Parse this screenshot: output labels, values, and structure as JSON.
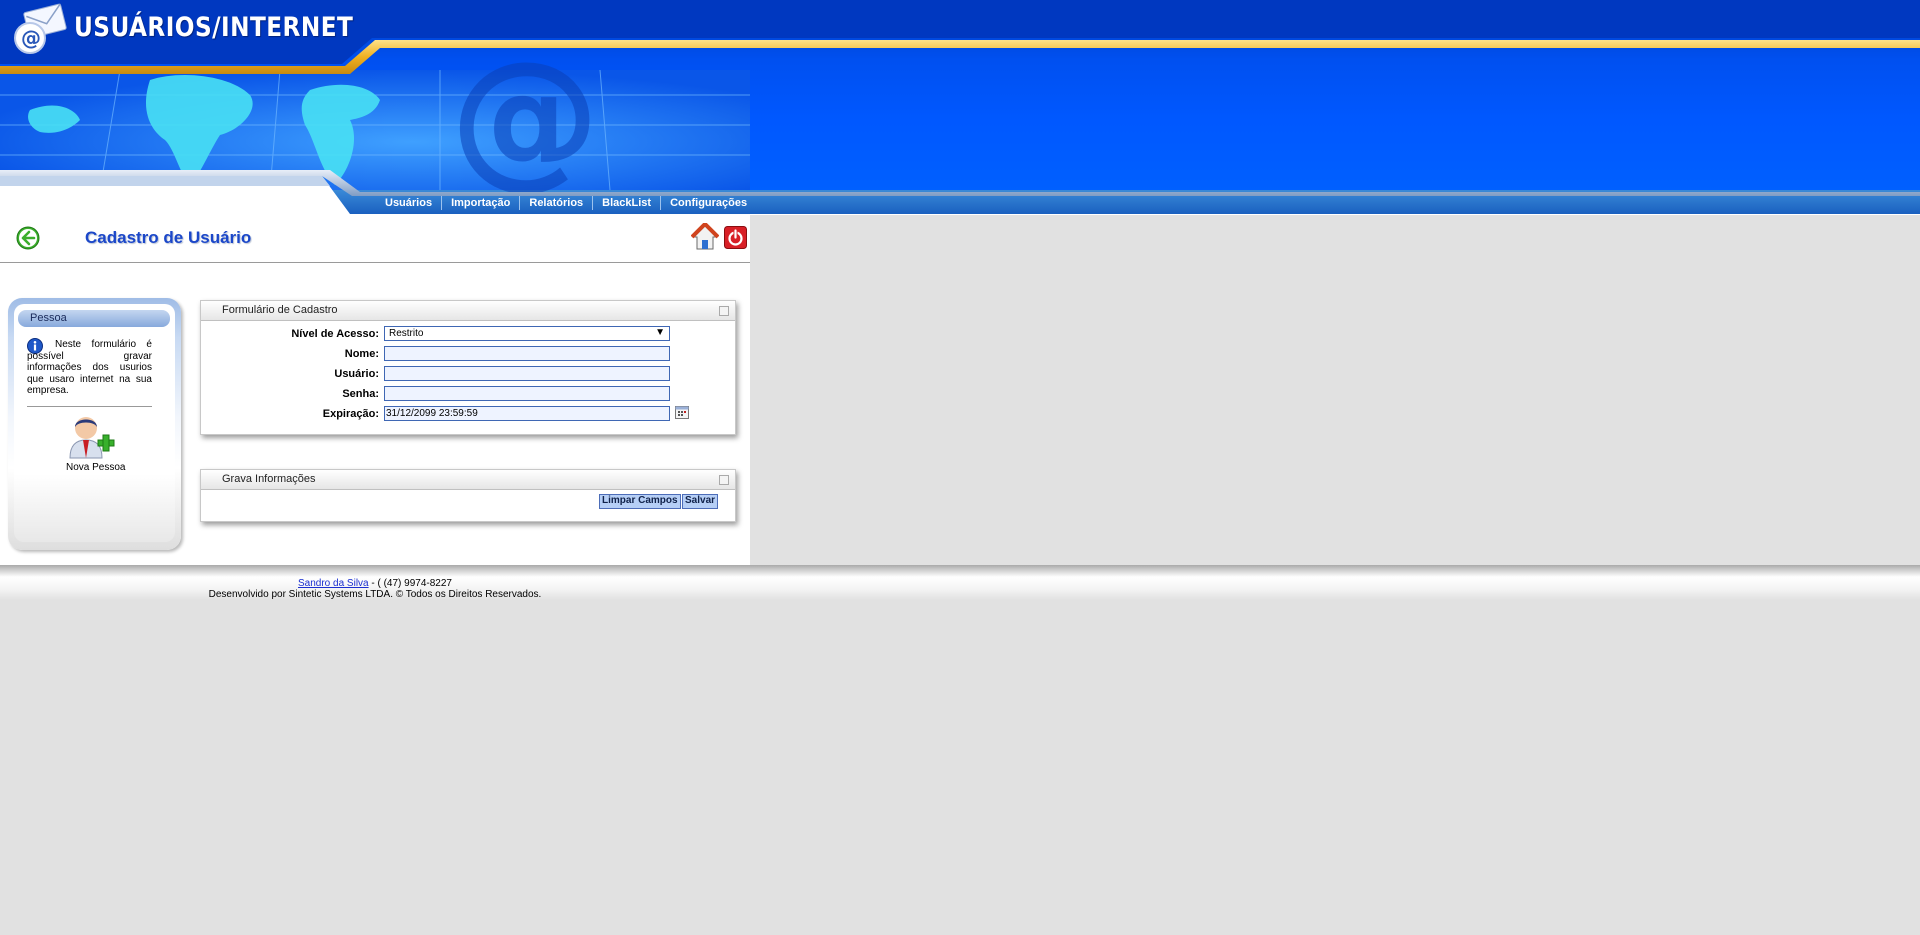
{
  "app": {
    "title": "USUÁRIOS/INTERNET"
  },
  "nav": {
    "items": [
      "Usuários",
      "Importação",
      "Relatórios",
      "BlackList",
      "Configurações"
    ]
  },
  "page": {
    "title": "Cadastro de Usuário"
  },
  "sidebar": {
    "title": "Pessoa",
    "description": "Neste formulário é possível gravar informações dos usurios que usaro internet na sua empresa.",
    "new_person_label": "Nova Pessoa"
  },
  "form": {
    "title": "Formulário de Cadastro",
    "fields": {
      "access_level": {
        "label": "Nível de Acesso:",
        "value": "Restrito"
      },
      "name": {
        "label": "Nome:",
        "value": ""
      },
      "user": {
        "label": "Usuário:",
        "value": ""
      },
      "password": {
        "label": "Senha:",
        "value": ""
      },
      "expiration": {
        "label": "Expiração:",
        "value": "31/12/2099 23:59:59"
      }
    }
  },
  "save_panel": {
    "title": "Grava Informações",
    "clear_label": "Limpar Campos",
    "save_label": "Salvar"
  },
  "footer": {
    "author": "Sandro da Silva",
    "phone": " - ( (47) 9974-8227",
    "copyright": "Desenvolvido por Sintetic Systems LTDA. © Todos os Direitos Reservados."
  },
  "icons": {
    "logo": "email-at-icon",
    "back": "back-arrow-icon",
    "home": "home-icon",
    "power": "power-icon",
    "info": "info-icon",
    "new_person": "add-person-icon",
    "calendar": "calendar-icon"
  },
  "colors": {
    "header_blue": "#0050f0",
    "accent_gold": "#f0b020",
    "title_blue": "#1b47c9"
  }
}
